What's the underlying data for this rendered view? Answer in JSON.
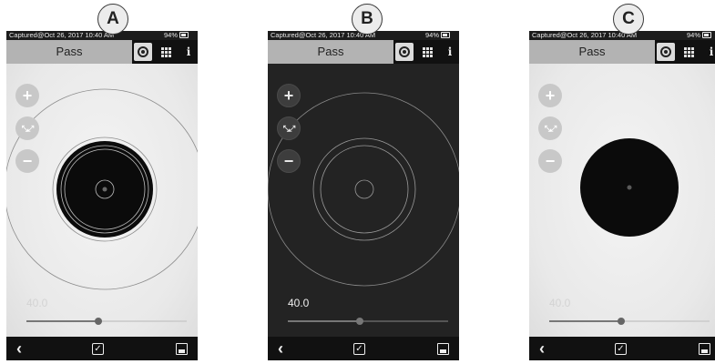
{
  "panels": [
    {
      "badge": "A",
      "status": "Captured@Oct 26, 2017 10:40 AM",
      "battery": "94%",
      "title": "Pass",
      "slider_value": "40.0",
      "slider_level": 0.45
    },
    {
      "badge": "B",
      "status": "Captured@Oct 26, 2017 10:40 AM",
      "battery": "94%",
      "title": "Pass",
      "slider_value": "40.0",
      "slider_level": 0.45
    },
    {
      "badge": "C",
      "status": "Captured@Oct 26, 2017 10:40 AM",
      "battery": "94%",
      "title": "Pass",
      "slider_value": "40.0",
      "slider_level": 0.45
    }
  ],
  "icons": {
    "zoom_in": "+",
    "zoom_fit": "⤡⤢",
    "zoom_out": "−",
    "back": "‹",
    "check": "✓",
    "info": "i"
  }
}
